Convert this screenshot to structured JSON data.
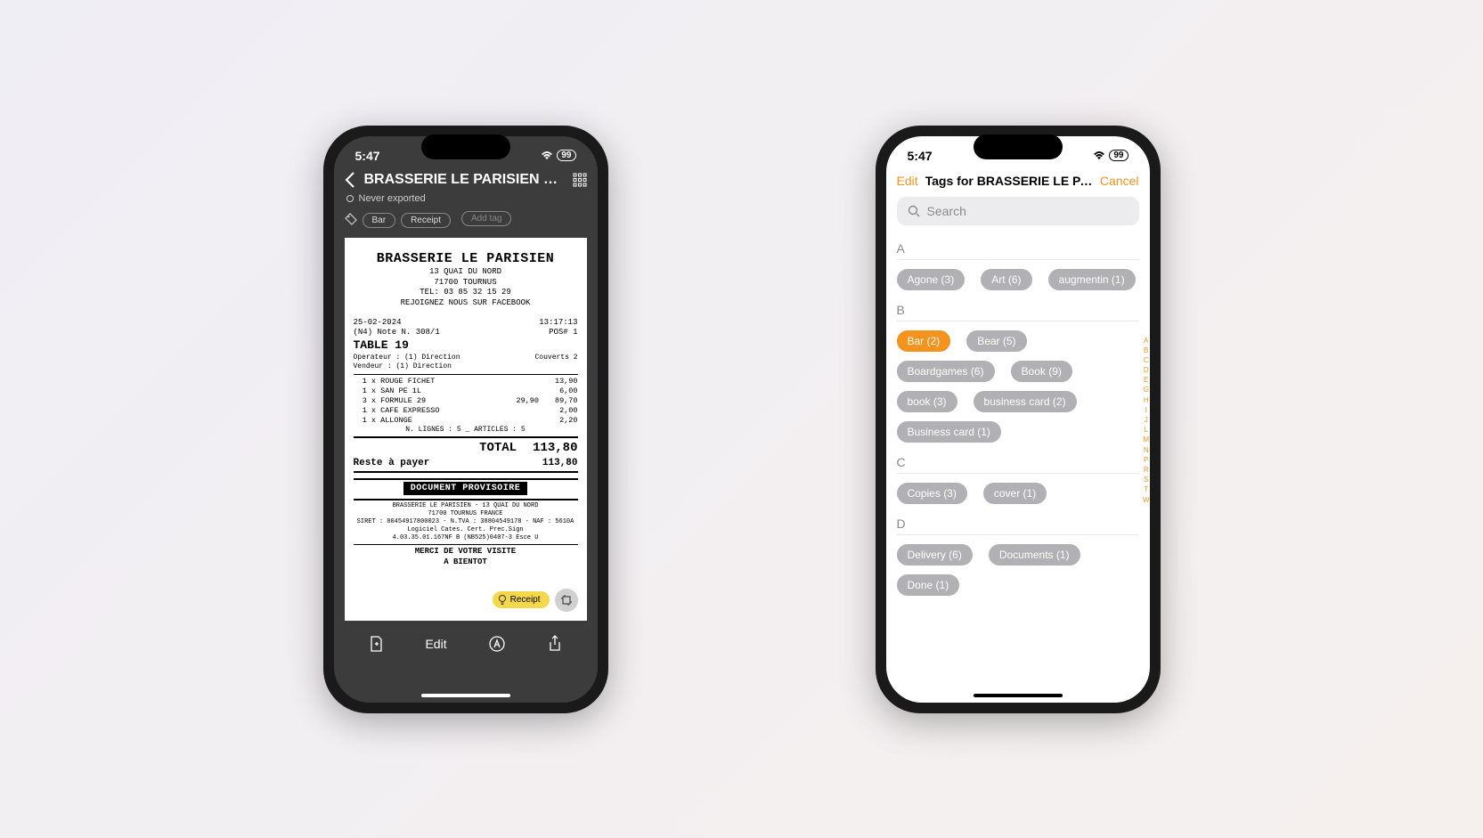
{
  "status": {
    "time": "5:47",
    "battery": "99"
  },
  "left": {
    "title": "BRASSERIE LE PARISIEN R...",
    "export_status": "Never exported",
    "tags": [
      "Bar",
      "Receipt"
    ],
    "add_tag_label": "Add tag",
    "receipt": {
      "merchant": "BRASSERIE LE PARISIEN",
      "addr1": "13 QUAI DU NORD",
      "addr2": "71700 TOURNUS",
      "tel": "TEL: 03 85 32 15 29",
      "fb": "REJOIGNEZ NOUS SUR FACEBOOK",
      "date": "25-02-2024",
      "time": "13:17:13",
      "note": "(N4) Note N. 308/1",
      "pos": "POS# 1",
      "table": "TABLE 19",
      "operator": "Operateur : (1) Direction",
      "covers": "Couverts  2",
      "vendeur": "Vendeur  : (1) Direction",
      "items": [
        {
          "line": "1 x ROUGE FICHET",
          "sub": "",
          "price": "13,90"
        },
        {
          "line": "1 x SAN PE 1L",
          "sub": "",
          "price": "6,00"
        },
        {
          "line": "3 x FORMULE 29",
          "sub": "29,90",
          "price": "89,70"
        },
        {
          "line": "1 x CAFE EXPRESSO",
          "sub": "",
          "price": "2,00"
        },
        {
          "line": "1 x ALLONGE",
          "sub": "",
          "price": "2,20"
        }
      ],
      "summary_line": "N. LIGNES : 5 _ ARTICLES : 5",
      "total_label": "TOTAL",
      "total": "113,80",
      "rest_label": "Reste à payer",
      "rest": "113,80",
      "doc_prov": "DOCUMENT PROVISOIRE",
      "footer1": "BRASSERIE LE PARISIEN - 13 QUAI DU NORD",
      "footer2": "71700 TOURNUS FRANCE",
      "footer3": "SIRET : 80454917800023 - N.TVA : 38804549178 - NAF : 5610A",
      "footer4": "Logiciel   Cates.  Cert. Prec.Sign",
      "footer5": "4.03.35.01.167NF B (NB525)0407-3 Esce U",
      "merci": "MERCI DE VOTRE VISITE",
      "bientot": "A BIENTOT"
    },
    "chip_label": "Receipt",
    "edit_label": "Edit"
  },
  "right": {
    "edit": "Edit",
    "title": "Tags for BRASSERIE LE PARISI...",
    "cancel": "Cancel",
    "search_placeholder": "Search",
    "sections": [
      {
        "letter": "A",
        "tags": [
          {
            "label": "Agone (3)",
            "active": false
          },
          {
            "label": "Art (6)",
            "active": false
          },
          {
            "label": "augmentin (1)",
            "active": false
          }
        ]
      },
      {
        "letter": "B",
        "tags": [
          {
            "label": "Bar (2)",
            "active": true
          },
          {
            "label": "Bear (5)",
            "active": false
          },
          {
            "label": "Boardgames (6)",
            "active": false
          },
          {
            "label": "Book (9)",
            "active": false
          },
          {
            "label": "book (3)",
            "active": false
          },
          {
            "label": "business card (2)",
            "active": false
          },
          {
            "label": "Business card (1)",
            "active": false
          }
        ]
      },
      {
        "letter": "C",
        "tags": [
          {
            "label": "Copies (3)",
            "active": false
          },
          {
            "label": "cover (1)",
            "active": false
          }
        ]
      },
      {
        "letter": "D",
        "tags": [
          {
            "label": "Delivery (6)",
            "active": false
          },
          {
            "label": "Documents (1)",
            "active": false
          },
          {
            "label": "Done (1)",
            "active": false
          }
        ]
      }
    ],
    "index": [
      "A",
      "B",
      "C",
      "D",
      "E",
      "G",
      "H",
      "I",
      "J",
      "L",
      "M",
      "N",
      "P",
      "R",
      "S",
      "T",
      "W"
    ]
  }
}
